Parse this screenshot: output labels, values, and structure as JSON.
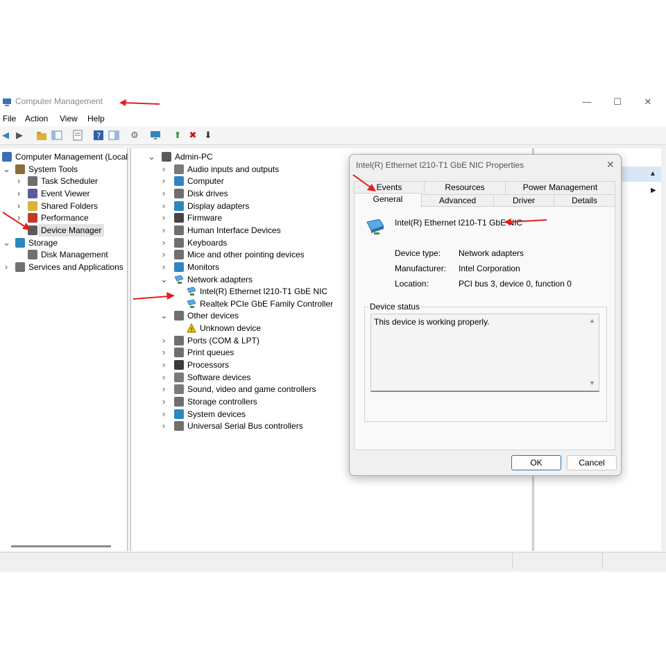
{
  "window": {
    "title": "Computer Management",
    "controls": {
      "minimize": "—",
      "maximize": "☐",
      "close": "✕"
    }
  },
  "menu": [
    "File",
    "Action",
    "View",
    "Help"
  ],
  "left_tree": [
    {
      "label": "Computer Management (Local",
      "level": 0,
      "expander": "",
      "icon": "computer-management-icon",
      "color": "#3b6fb6"
    },
    {
      "label": "System Tools",
      "level": 1,
      "expander": "v",
      "icon": "tools-icon",
      "color": "#8a6d3b"
    },
    {
      "label": "Task Scheduler",
      "level": 2,
      "expander": ">",
      "icon": "clock-icon",
      "color": "#6f6f6f"
    },
    {
      "label": "Event Viewer",
      "level": 2,
      "expander": ">",
      "icon": "event-viewer-icon",
      "color": "#5b5b9b"
    },
    {
      "label": "Shared Folders",
      "level": 2,
      "expander": ">",
      "icon": "shared-folder-icon",
      "color": "#d9b23a"
    },
    {
      "label": "Performance",
      "level": 2,
      "expander": ">",
      "icon": "performance-icon",
      "color": "#c0392b"
    },
    {
      "label": "Device Manager",
      "level": 2,
      "expander": "",
      "icon": "device-manager-icon",
      "color": "#5a5a5a",
      "selected": true
    },
    {
      "label": "Storage",
      "level": 1,
      "expander": "v",
      "icon": "storage-icon",
      "color": "#2e86c1"
    },
    {
      "label": "Disk Management",
      "level": 2,
      "expander": "",
      "icon": "disk-management-icon",
      "color": "#6f6f6f"
    },
    {
      "label": "Services and Applications",
      "level": 1,
      "expander": ">",
      "icon": "services-icon",
      "color": "#707070"
    }
  ],
  "device_tree": [
    {
      "label": "Admin-PC",
      "level": 0,
      "expander": "v",
      "icon": "pc-icon",
      "color": "#5a5a5a"
    },
    {
      "label": "Audio inputs and outputs",
      "level": 1,
      "expander": ">",
      "icon": "speaker-icon",
      "color": "#7a7a7a"
    },
    {
      "label": "Computer",
      "level": 1,
      "expander": ">",
      "icon": "monitor-icon",
      "color": "#2e86c1"
    },
    {
      "label": "Disk drives",
      "level": 1,
      "expander": ">",
      "icon": "disk-drive-icon",
      "color": "#6f6f6f"
    },
    {
      "label": "Display adapters",
      "level": 1,
      "expander": ">",
      "icon": "display-adapter-icon",
      "color": "#2e86c1"
    },
    {
      "label": "Firmware",
      "level": 1,
      "expander": ">",
      "icon": "chip-icon",
      "color": "#444444"
    },
    {
      "label": "Human Interface Devices",
      "level": 1,
      "expander": ">",
      "icon": "hid-icon",
      "color": "#6f6f6f"
    },
    {
      "label": "Keyboards",
      "level": 1,
      "expander": ">",
      "icon": "keyboard-icon",
      "color": "#6f6f6f"
    },
    {
      "label": "Mice and other pointing devices",
      "level": 1,
      "expander": ">",
      "icon": "mouse-icon",
      "color": "#6f6f6f"
    },
    {
      "label": "Monitors",
      "level": 1,
      "expander": ">",
      "icon": "monitor-icon",
      "color": "#2e86c1"
    },
    {
      "label": "Network adapters",
      "level": 1,
      "expander": "v",
      "icon": "network-icon",
      "color": "#2e86c1"
    },
    {
      "label": "Intel(R) Ethernet I210-T1 GbE NIC",
      "level": 2,
      "expander": "",
      "icon": "network-adapter-icon",
      "color": "#2e86c1"
    },
    {
      "label": "Realtek PCIe GbE Family Controller",
      "level": 2,
      "expander": "",
      "icon": "network-adapter-icon",
      "color": "#2e86c1"
    },
    {
      "label": "Other devices",
      "level": 1,
      "expander": "v",
      "icon": "other-devices-icon",
      "color": "#6f6f6f"
    },
    {
      "label": "Unknown device",
      "level": 2,
      "expander": "",
      "icon": "warning-device-icon",
      "color": "#d4a017"
    },
    {
      "label": "Ports (COM & LPT)",
      "level": 1,
      "expander": ">",
      "icon": "port-icon",
      "color": "#6f6f6f"
    },
    {
      "label": "Print queues",
      "level": 1,
      "expander": ">",
      "icon": "printer-icon",
      "color": "#6f6f6f"
    },
    {
      "label": "Processors",
      "level": 1,
      "expander": ">",
      "icon": "processor-icon",
      "color": "#3a3a3a"
    },
    {
      "label": "Software devices",
      "level": 1,
      "expander": ">",
      "icon": "software-device-icon",
      "color": "#7a7a7a"
    },
    {
      "label": "Sound, video and game controllers",
      "level": 1,
      "expander": ">",
      "icon": "sound-icon",
      "color": "#7a7a7a"
    },
    {
      "label": "Storage controllers",
      "level": 1,
      "expander": ">",
      "icon": "storage-controller-icon",
      "color": "#6f6f6f"
    },
    {
      "label": "System devices",
      "level": 1,
      "expander": ">",
      "icon": "system-device-icon",
      "color": "#2e86c1"
    },
    {
      "label": "Universal Serial Bus controllers",
      "level": 1,
      "expander": ">",
      "icon": "usb-icon",
      "color": "#6f6f6f"
    }
  ],
  "dialog": {
    "title": "Intel(R) Ethernet I210-T1 GbE NIC Properties",
    "close": "✕",
    "tabs_top": [
      "Events",
      "Resources",
      "Power Management"
    ],
    "tabs_bottom": [
      "General",
      "Advanced",
      "Driver",
      "Details"
    ],
    "device_name": "Intel(R) Ethernet I210-T1 GbE NIC",
    "device_type_label": "Device type:",
    "device_type": "Network adapters",
    "manufacturer_label": "Manufacturer:",
    "manufacturer": "Intel Corporation",
    "location_label": "Location:",
    "location": "PCI bus 3, device 0, function 0",
    "status_group": "Device status",
    "status_text": "This device is working properly.",
    "ok": "OK",
    "cancel": "Cancel"
  },
  "colors": {
    "annotation_arrow": "#e0201c",
    "accent": "#2e86c1"
  }
}
